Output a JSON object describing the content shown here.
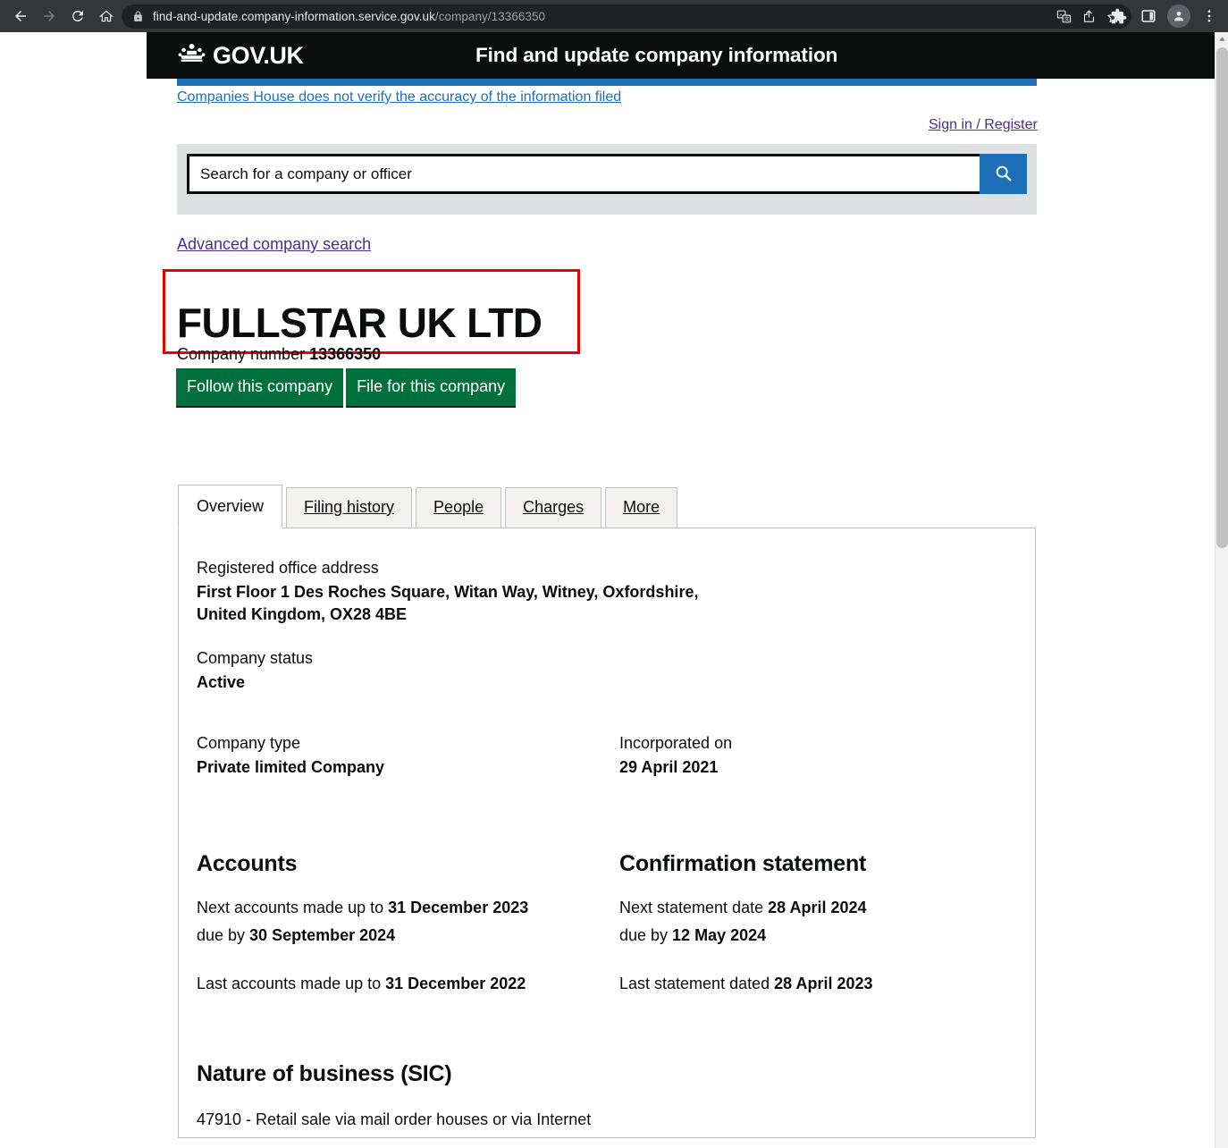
{
  "browser": {
    "nav": {
      "back": "back-arrow",
      "forward": "forward-arrow",
      "reload": "reload",
      "home": "home"
    },
    "url_domain": "find-and-update.company-information.service.gov.uk",
    "url_path": "/company/13366350",
    "omnibox_icons": [
      "translate-icon",
      "share-icon",
      "bookmark-star-icon"
    ],
    "toolbar_icons": [
      "extensions-puzzle-icon",
      "side-panel-icon",
      "profile-avatar-icon",
      "chrome-menu-icon"
    ]
  },
  "header": {
    "logo_text": "GOV.UK",
    "service_name": "Find and update company information",
    "notice": "Companies House does not verify the accuracy of the information filed",
    "sign_in": "Sign in / Register"
  },
  "search": {
    "placeholder": "Search for a company or officer",
    "value": "",
    "button_icon": "search-icon",
    "advanced_link": "Advanced company search"
  },
  "company": {
    "name": "FULLSTAR UK LTD",
    "number_label": "Company number",
    "number": "13366350",
    "follow_button": "Follow this company",
    "file_button": "File for this company"
  },
  "tabs": [
    {
      "label": "Overview",
      "active": true
    },
    {
      "label": "Filing history",
      "active": false
    },
    {
      "label": "People",
      "active": false
    },
    {
      "label": "Charges",
      "active": false
    },
    {
      "label": "More",
      "active": false
    }
  ],
  "overview": {
    "registered_office_label": "Registered office address",
    "registered_office_line1": "First Floor 1 Des Roches Square, Witan Way, Witney, Oxfordshire,",
    "registered_office_line2": "United Kingdom, OX28 4BE",
    "company_status_label": "Company status",
    "company_status": "Active",
    "company_type_label": "Company type",
    "company_type": "Private limited Company",
    "incorporated_label": "Incorporated on",
    "incorporated_on": "29 April 2021",
    "accounts": {
      "heading": "Accounts",
      "next_prefix": "Next accounts made up to ",
      "next_date": "31 December 2023",
      "due_prefix": "due by ",
      "due_date": "30 September 2024",
      "last_prefix": "Last accounts made up to ",
      "last_date": "31 December 2022"
    },
    "confirmation": {
      "heading": "Confirmation statement",
      "next_prefix": "Next statement date ",
      "next_date": "28 April 2024",
      "due_prefix": "due by ",
      "due_date": "12 May 2024",
      "last_prefix": "Last statement dated ",
      "last_date": "28 April 2023"
    },
    "sic": {
      "heading": "Nature of business (SIC)",
      "code_line": "47910 - Retail sale via mail order houses or via Internet"
    }
  },
  "colors": {
    "govuk_black": "#0b0c0c",
    "govuk_blue": "#1d70b8",
    "govuk_green": "#00703c",
    "link_purple": "#4c2c92",
    "annotation_red": "#ee0000"
  }
}
